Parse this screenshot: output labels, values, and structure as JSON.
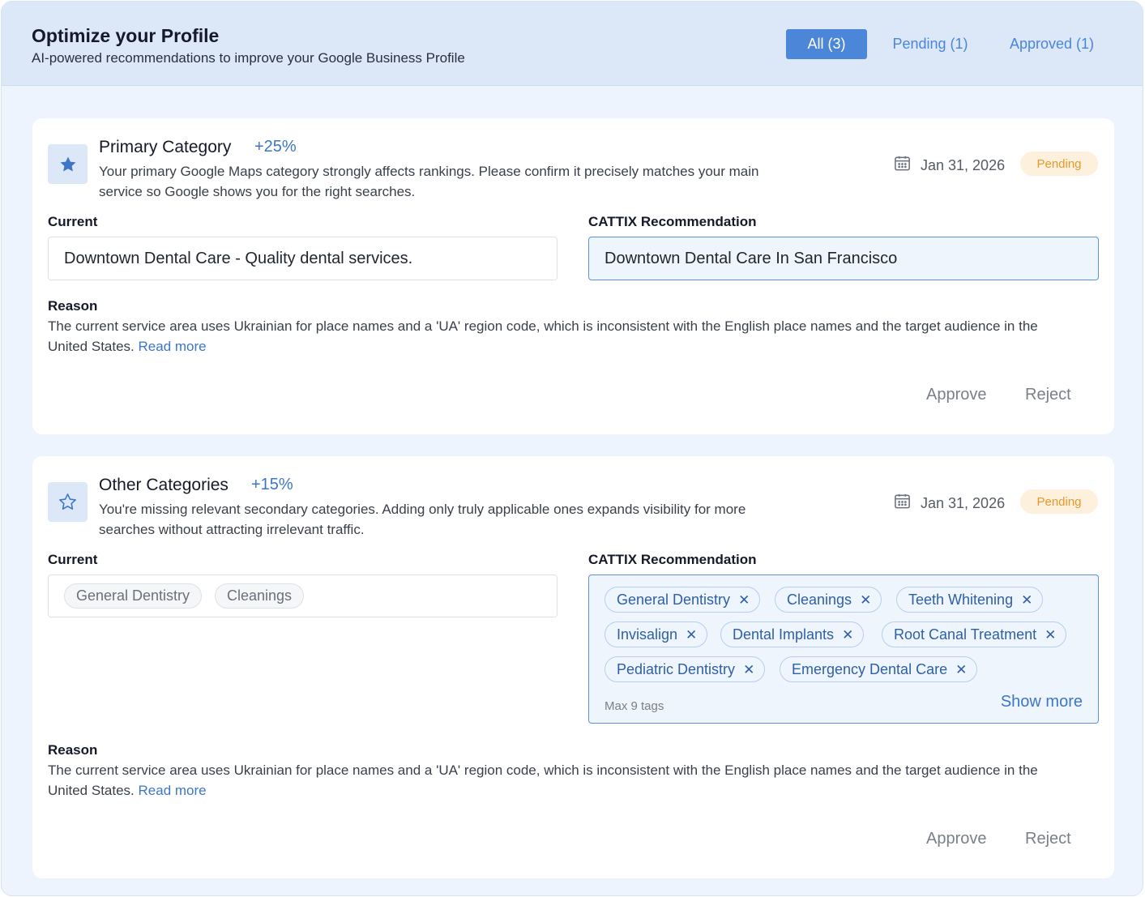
{
  "header": {
    "title": "Optimize your Profile",
    "subtitle": "AI-powered recommendations to improve your Google Business Profile"
  },
  "filters": {
    "all": "All (3)",
    "pending": "Pending (1)",
    "approved": "Approved (1)"
  },
  "cards": [
    {
      "title": "Primary Category",
      "boost": "+25%",
      "description": "Your primary Google Maps category strongly affects rankings. Please confirm it precisely matches your main service so Google shows you for the right searches.",
      "date": "Jan 31, 2026",
      "status": "Pending",
      "current_label": "Current",
      "current_value": "Downtown Dental Care - Quality dental services.",
      "reco_label": "CATTIX Recommendation",
      "reco_value": "Downtown Dental Care In San Francisco",
      "reason_label": "Reason",
      "reason_text": "The current service area uses Ukrainian for place names and a 'UA' region code, which is inconsistent with the English place names and the target audience in the United States.",
      "read_more": "Read more",
      "approve": "Approve",
      "reject": "Reject"
    },
    {
      "title": "Other Categories",
      "boost": "+15%",
      "description": "You're missing relevant secondary categories. Adding only truly applicable ones expands visibility for more searches without attracting irrelevant traffic.",
      "date": "Jan 31, 2026",
      "status": "Pending",
      "current_label": "Current",
      "current_tags": [
        "General Dentistry",
        "Cleanings"
      ],
      "reco_label": "CATTIX Recommendation",
      "reco_tags": [
        "General Dentistry",
        "Cleanings",
        "Teeth Whitening",
        "Invisalign",
        "Dental Implants",
        "Root Canal Treatment",
        "Pediatric Dentistry",
        "Emergency Dental Care"
      ],
      "max_tags": "Max 9 tags",
      "show_more": "Show more",
      "reason_label": "Reason",
      "reason_text": "The current service area uses Ukrainian for place names and a 'UA' region code, which is inconsistent with the English place names and the target audience in the United States.",
      "read_more": "Read more",
      "approve": "Approve",
      "reject": "Reject"
    }
  ],
  "icons": {
    "primary": "star-filled-icon",
    "other": "star-outline-icon",
    "date": "calendar-icon",
    "remove": "close-icon"
  },
  "colors": {
    "accent": "#4b86d9",
    "pending_text": "#e59a2b",
    "pending_bg": "#fdf1dd"
  }
}
